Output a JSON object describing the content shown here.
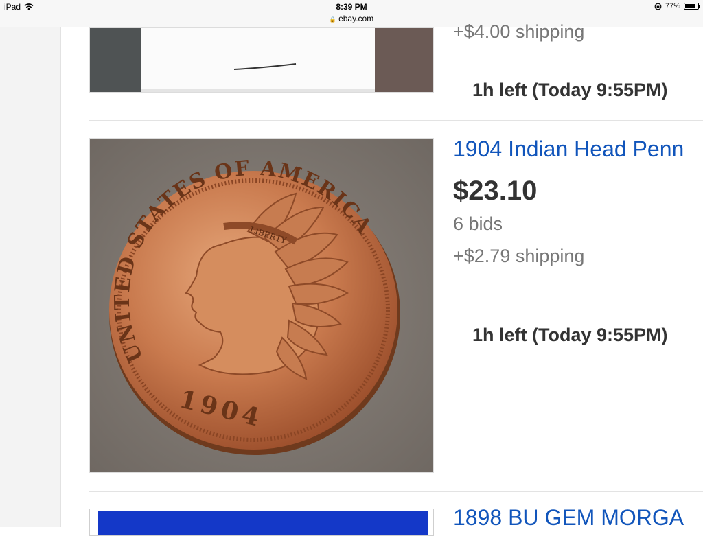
{
  "status_bar": {
    "device": "iPad",
    "time": "8:39 PM",
    "url": "ebay.com",
    "battery": "77%",
    "battery_level": 0.77
  },
  "listings": [
    {
      "shipping": "+$4.00 shipping",
      "time_left": "1h left (Today 9:55PM)"
    },
    {
      "title": "1904 Indian Head Penn",
      "price": "$23.10",
      "bids": "6 bids",
      "shipping": "+$2.79 shipping",
      "time_left": "1h left (Today 9:55PM)",
      "coin_text": {
        "top": "UNITED STATES OF AMERICA",
        "band": "LIBERTY",
        "year": "1904"
      }
    },
    {
      "title": "1898 BU GEM MORGA"
    }
  ]
}
